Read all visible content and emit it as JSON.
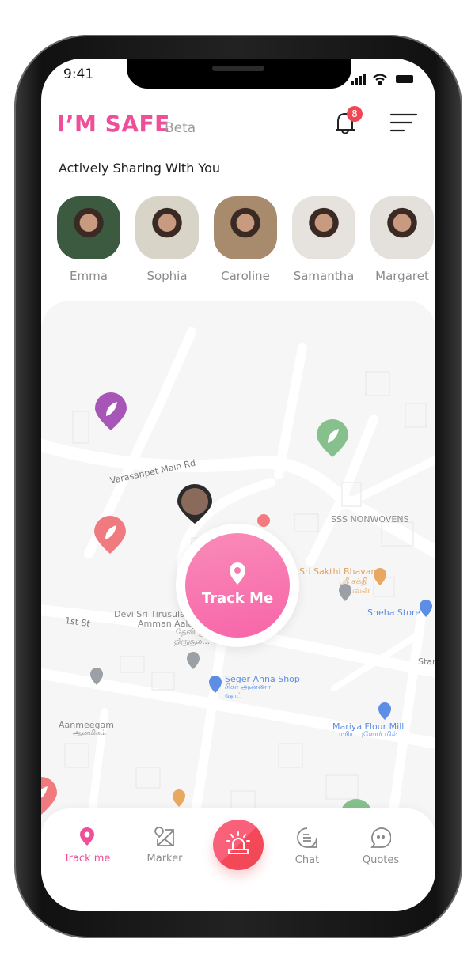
{
  "status_bar": {
    "time": "9:41"
  },
  "header": {
    "logo": "I’M SAFE",
    "beta": "Beta",
    "notification_count": "8"
  },
  "sharing": {
    "title": "Actively Sharing With You",
    "contacts": [
      {
        "name": "Emma",
        "color": "#3c5a40"
      },
      {
        "name": "Sophia",
        "color": "#d8d4c8"
      },
      {
        "name": "Caroline",
        "color": "#a88a6c"
      },
      {
        "name": "Samantha",
        "color": "#e6e2de"
      },
      {
        "name": "Margaret",
        "color": "#e4e0dc"
      }
    ]
  },
  "map": {
    "labels": {
      "street1": "Varasanpet Main Rd",
      "sss": "SSS NONWOVENS",
      "sakthi": "Sri Sakthi Bhavan",
      "sakthi_ta1": "ஸ்ரீ சக்தி",
      "sakthi_ta2": "பவன்",
      "sneha": "Sneha Store",
      "devi1": "Devi Sri Tirusula N",
      "devi2": "Amman Aalay",
      "devi_ta1": "தேவி ஸ்ரீ",
      "devi_ta2": "திருசூல...",
      "first": "1st St",
      "aanmeegam": "Aanmeegam",
      "aanmeegam_ta": "ஆன்மிகம்",
      "seger": "Seger Anna Shop",
      "seger_ta1": "சிகர் அண்ணா",
      "seger_ta2": "ஷாப்",
      "mariya": "Mariya Flour Mill",
      "mariya_ta": "மரிய புளோர் மில்",
      "star": "Star"
    },
    "track_button": "Track Me"
  },
  "nav": {
    "items": [
      {
        "label": "Track me",
        "active": true
      },
      {
        "label": "Marker"
      },
      {
        "label": "Chat"
      },
      {
        "label": "Quotes"
      }
    ]
  },
  "colors": {
    "brand": "#ef4f98",
    "sos": "#f24857",
    "inactive": "#8c8c8c"
  }
}
